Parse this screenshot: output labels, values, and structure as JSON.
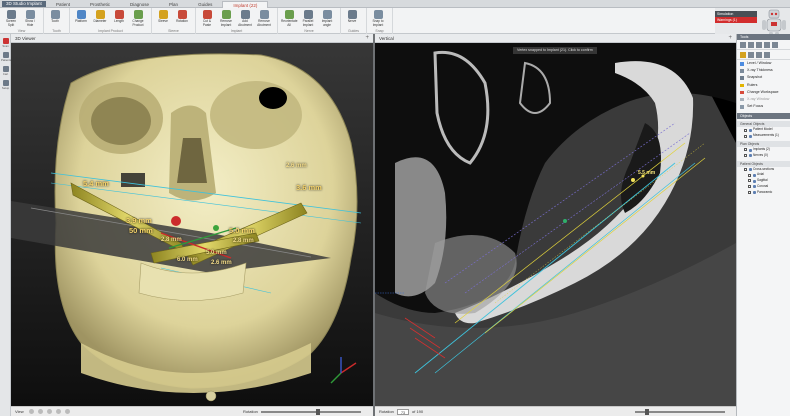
{
  "app": {
    "title": "3D Studio Implant"
  },
  "tabs": [
    {
      "label": "Patient",
      "active": false
    },
    {
      "label": "Prosthetic",
      "active": false
    },
    {
      "label": "Diagnose",
      "active": false
    },
    {
      "label": "Plan",
      "active": false
    },
    {
      "label": "Guides",
      "active": false
    },
    {
      "label": "Implant (22)",
      "active": true
    }
  ],
  "ribbon": {
    "groups": [
      {
        "label": "View",
        "buttons": [
          "Screen Split",
          "Show / Hide"
        ]
      },
      {
        "label": "Tooth",
        "buttons": [
          "Tooth"
        ]
      },
      {
        "label": "Implant Product",
        "buttons": [
          "Platform",
          "Diameter",
          "Length",
          "Change Product"
        ]
      },
      {
        "label": "Sleeve",
        "buttons": [
          "Sleeve",
          "Rotation"
        ]
      },
      {
        "label": "Implant",
        "buttons": [
          "Cut & Paste",
          "Remove Implant",
          "Add Abutment",
          "Remove Abutment"
        ]
      },
      {
        "label": "Nerve",
        "buttons": [
          "Reorientate All",
          "Parallel Implant",
          "Implant angle"
        ]
      },
      {
        "label": "Guides",
        "buttons": [
          "Nerve"
        ]
      },
      {
        "label": "Snap",
        "buttons": [
          "Snap to Implant"
        ]
      }
    ]
  },
  "status": {
    "top": "Simulation",
    "bottom": "Warnings (1)"
  },
  "left_tools": [
    "Scan",
    "Patients",
    "Cart",
    "Setup"
  ],
  "viewport_3d": {
    "title": "3D Viewer",
    "measurements": [
      {
        "text": "5.4 mm",
        "class": ""
      },
      {
        "text": "2.6 mm",
        "class": "small"
      },
      {
        "text": "3.9 mm",
        "class": ""
      },
      {
        "text": "50 mm",
        "class": ""
      },
      {
        "text": "3.6 mm",
        "class": ""
      },
      {
        "text": "2.8 mm",
        "class": "small"
      },
      {
        "text": "5.0 mm",
        "class": ""
      },
      {
        "text": "2.8 mm",
        "class": "small"
      },
      {
        "text": "5.0 mm",
        "class": "small"
      },
      {
        "text": "2.6 mm",
        "class": "small"
      },
      {
        "text": "6.0 mm",
        "class": "small"
      }
    ],
    "bottom": {
      "view_label": "View",
      "rotation_label": "Rotation"
    }
  },
  "viewport_ct": {
    "title": "Vertical",
    "toast": "Vertex snapped to Implant (21). Click to confirm",
    "measurement": "5.5 mm",
    "bottom": {
      "label": "Rotation",
      "slice_value": "73",
      "slice_total": "of 190"
    }
  },
  "right_panel": {
    "header": "Tools",
    "items": [
      {
        "label": "Level / Window",
        "color": "#4c8be0",
        "disabled": false
      },
      {
        "label": "X-ray Thickness",
        "color": "#7b8a9a",
        "disabled": false
      },
      {
        "label": "Snapshot",
        "color": "#6e7d8d",
        "disabled": false
      },
      {
        "label": "Rulers",
        "color": "#e2b400",
        "disabled": false
      },
      {
        "label": "Change Workspace",
        "color": "#d74b3b",
        "disabled": false
      },
      {
        "label": "X-ray Window",
        "color": "#a9b2bb",
        "disabled": true
      },
      {
        "label": "Set Focus",
        "color": "#8a99a8",
        "disabled": false
      }
    ],
    "objects_header": "Objects",
    "tree": [
      {
        "label": "General Objects",
        "level": 0,
        "kind": "section"
      },
      {
        "label": "Patient Model",
        "level": 1,
        "kind": "item"
      },
      {
        "label": "Measurements (1)",
        "level": 1,
        "kind": "item"
      },
      {
        "label": "Plan Objects",
        "level": 0,
        "kind": "section"
      },
      {
        "label": "Implants (2)",
        "level": 1,
        "kind": "item"
      },
      {
        "label": "Nerves (0)",
        "level": 1,
        "kind": "item"
      },
      {
        "label": "Patient Objects",
        "level": 0,
        "kind": "section"
      },
      {
        "label": "Cross-sections",
        "level": 1,
        "kind": "item"
      },
      {
        "label": "Axial",
        "level": 2,
        "kind": "item"
      },
      {
        "label": "Sagittal",
        "level": 2,
        "kind": "item"
      },
      {
        "label": "Coronal",
        "level": 2,
        "kind": "item"
      },
      {
        "label": "Panoramic",
        "level": 2,
        "kind": "item"
      }
    ]
  },
  "colors": {
    "accent_red": "#d22d2d",
    "bone": "#e9e3b5",
    "implant_gold": "#c7ba3a",
    "guide_cyan": "#34b8d4"
  }
}
